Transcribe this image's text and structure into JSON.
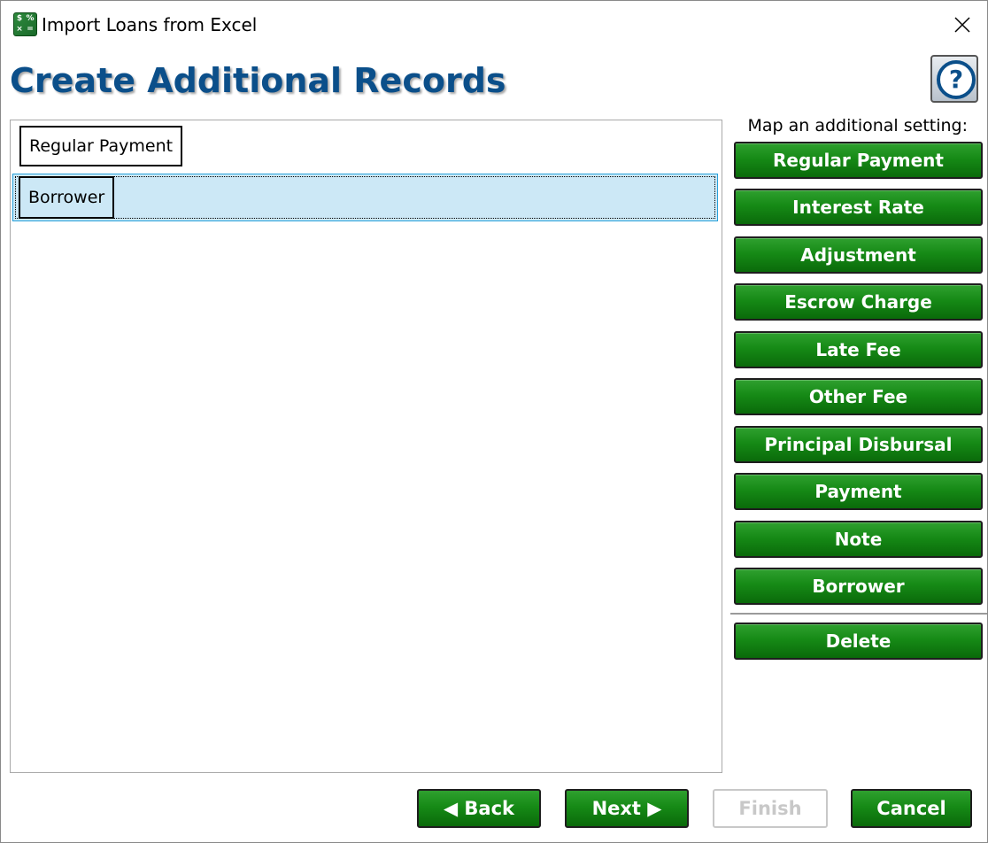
{
  "window": {
    "title": "Import Loans from Excel",
    "icon": "excel-calculator-icon",
    "icon_glyphs": [
      "$",
      "%",
      "×",
      "="
    ]
  },
  "page": {
    "title": "Create Additional Records",
    "help_label": "?"
  },
  "records": [
    {
      "label": "Regular Payment",
      "selected": false
    },
    {
      "label": "Borrower",
      "selected": true
    }
  ],
  "map_panel": {
    "label": "Map an additional setting:",
    "buttons": [
      "Regular Payment",
      "Interest Rate",
      "Adjustment",
      "Escrow Charge",
      "Late Fee",
      "Other Fee",
      "Principal Disbursal",
      "Payment",
      "Note",
      "Borrower"
    ],
    "delete_label": "Delete"
  },
  "footer": {
    "back_label": "◀ Back",
    "next_label": "Next ▶",
    "finish_label": "Finish",
    "finish_enabled": false,
    "cancel_label": "Cancel"
  },
  "colors": {
    "title_blue": "#0b4f8a",
    "button_green": "#168a16",
    "selection_bg": "#cce8f6",
    "selection_border": "#26a0da"
  }
}
